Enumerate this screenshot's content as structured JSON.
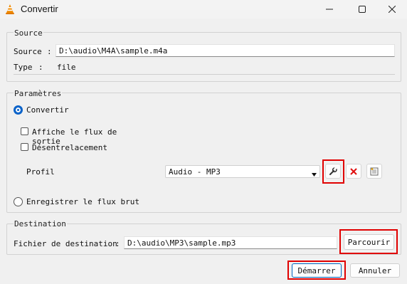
{
  "window": {
    "title": "Convertir",
    "controls": {
      "minimize": "minimize",
      "maximize": "maximize",
      "close": "close"
    }
  },
  "source_group": {
    "title": "Source",
    "source_label": "Source",
    "colon": ":",
    "source_value": "D:\\audio\\M4A\\sample.m4a",
    "type_label": "Type",
    "type_value": "file"
  },
  "settings_group": {
    "title": "Paramètres",
    "convert_label": "Convertir",
    "convert_selected": true,
    "show_output_label": "Affiche le flux de sortie",
    "show_output_checked": false,
    "deinterlace_label": "Désentrelacement",
    "deinterlace_checked": false,
    "profile_label": "Profil",
    "profile_value": "Audio - MP3",
    "raw_dump_label": "Enregistrer le flux brut",
    "raw_dump_selected": false
  },
  "destination_group": {
    "title": "Destination",
    "file_label": "Fichier de destination",
    "colon": ":",
    "file_value": "D:\\audio\\MP3\\sample.mp3",
    "browse_label": "Parcourir"
  },
  "footer": {
    "start_label": "Démarrer",
    "cancel_label": "Annuler"
  },
  "colors": {
    "accent": "#0b63c9",
    "highlight": "#e00000",
    "delete": "#e01010",
    "vlc_orange": "#f08a00"
  }
}
